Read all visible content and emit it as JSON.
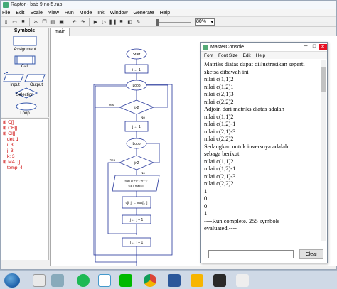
{
  "window": {
    "title": "Raptor - bab 9 no 5.rap"
  },
  "menu": [
    "File",
    "Edit",
    "Scale",
    "View",
    "Run",
    "Mode",
    "Ink",
    "Window",
    "Generate",
    "Help"
  ],
  "toolbar": {
    "zoom": "80%"
  },
  "symbols": {
    "header": "Symbols",
    "items": [
      "Assignment",
      "Call",
      "Input",
      "Output",
      "Selection",
      "Loop"
    ]
  },
  "variables": [
    "C[]",
    "CH[]",
    "CI[]",
    "det: 1",
    "i: 3",
    "j: 3",
    "k: 3",
    "MAT[]",
    "temp: 4"
  ],
  "tabs": [
    "main"
  ],
  "flow": {
    "start": "Start",
    "assign_i": "i ← 1",
    "loop1": "Loop",
    "yes": "Yes",
    "no": "No",
    "cond_i": "i>2",
    "assign_j": "j ← 1",
    "loop2": "Loop",
    "cond_j": "j>2",
    "output": "\"nilai c(\"+i+\",\"+j+\")\"",
    "output2": "GET mat[i,j]",
    "assign_c": "c[i, j] ← mat[i, j]",
    "inc_j": "j ← j + 1",
    "inc_i": "i ← i + 1"
  },
  "console": {
    "title": "MasterConsole",
    "menu": [
      "Font",
      "Font Size",
      "Edit",
      "Help"
    ],
    "lines": [
      "Matriks diatas dapat diilustrasikan seperti",
      "sketsa dibawah ini",
      "nilai c(1,1)2",
      "nilai c(1,2)1",
      "nilai c(2,1)3",
      "nilai c(2,2)2",
      "Adjoin dari matriks diatas adalah",
      "nilai c(1,1)2",
      "nilai c(1,2)-1",
      "nilai c(2,1)-3",
      "nilai c(2,2)2",
      "Sedangkan untuk inversnya adalah",
      "sebaga berikut",
      "nilai c(1,1)2",
      "nilai c(1,2)-1",
      "nilai c(2,1)-3",
      "nilai c(2,2)2",
      "1",
      "0",
      "0",
      "1",
      "----Run complete.  255 symbols",
      "evaluated.----"
    ],
    "clear_label": "Clear",
    "input_value": ""
  }
}
